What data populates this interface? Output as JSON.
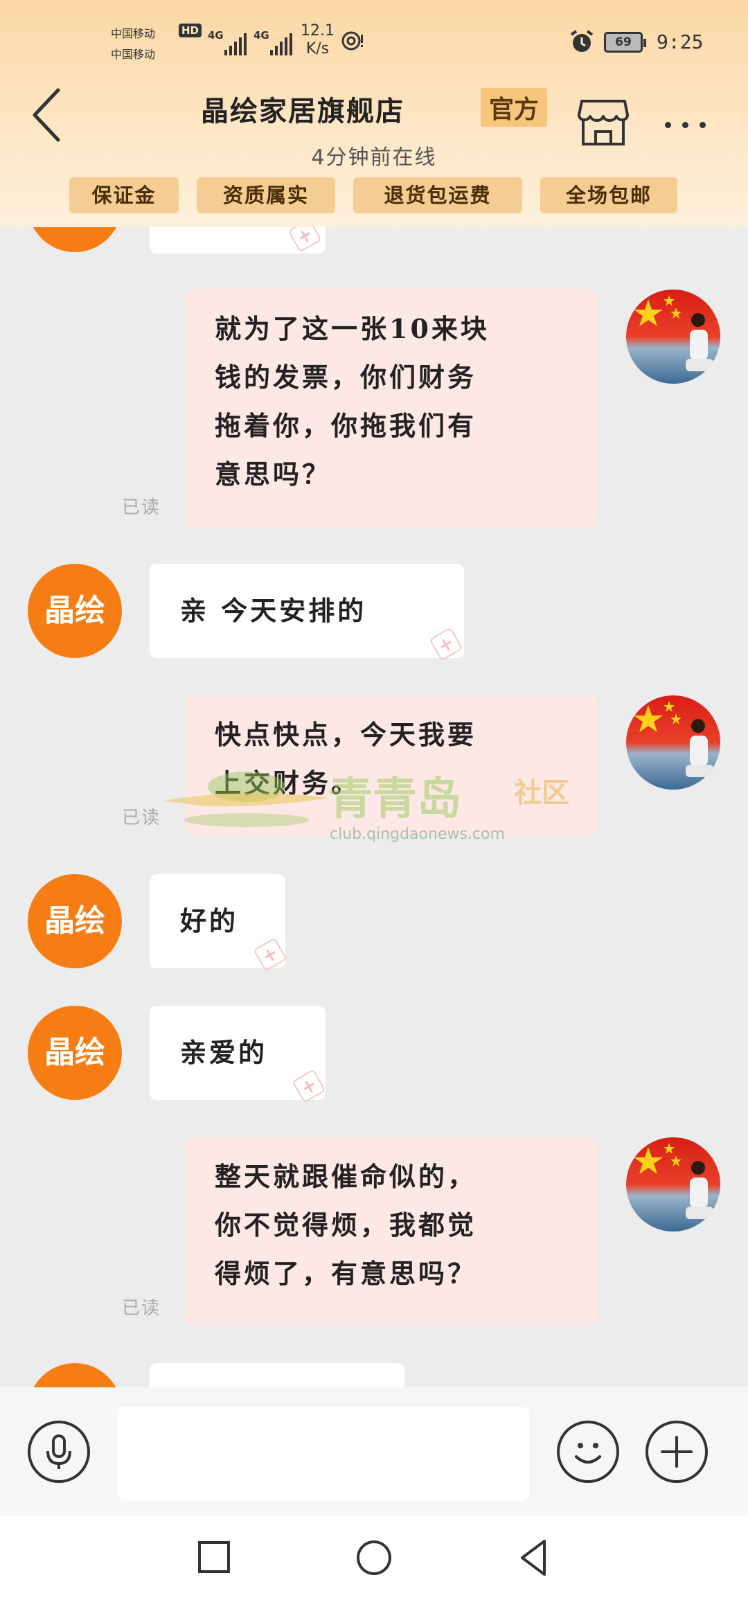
{
  "status_bar": {
    "carrier1": "中国移动",
    "carrier2": "中国移动",
    "hd": "HD",
    "network1": "4G",
    "network2": "4G",
    "speed_value": "12.1",
    "speed_unit": "K/s",
    "battery": "69",
    "time": "9:25"
  },
  "header": {
    "store_name": "晶绘家居旗舰店",
    "official_badge": "官方",
    "online_status": "4分钟前在线",
    "tags": [
      "保证金",
      "资质属实",
      "退货包运费",
      "全场包邮"
    ]
  },
  "chat": {
    "messages": [
      {
        "from": "user",
        "lines": [
          "就为了这一张10来块",
          "钱的发票，你们财务",
          "拖着你，你拖我们有",
          "意思吗？"
        ],
        "read": "已读"
      },
      {
        "from": "store",
        "avatar": "晶绘",
        "lines": [
          "亲  今天安排的"
        ]
      },
      {
        "from": "user",
        "lines": [
          "快点快点，今天我要",
          "上交财务。"
        ],
        "read": "已读"
      },
      {
        "from": "store",
        "avatar": "晶绘",
        "lines": [
          "好的"
        ]
      },
      {
        "from": "store",
        "avatar": "晶绘",
        "lines": [
          "亲爱的"
        ]
      },
      {
        "from": "user",
        "lines": [
          "整天就跟催命似的，",
          "你不觉得烦，我都觉",
          "得烦了，有意思吗？"
        ],
        "read": "已读"
      }
    ],
    "watermark": {
      "name": "青青岛",
      "suffix": "社区",
      "url": "club.qingdaonews.com"
    }
  },
  "input": {
    "placeholder": ""
  },
  "icons": {
    "back": "chevron-left-icon",
    "store": "store-icon",
    "more": "more-dots-icon",
    "voice": "microphone-icon",
    "emoji": "smiley-icon",
    "add": "plus-icon"
  },
  "colors": {
    "accent": "#f57d14",
    "header_bg": "#fde6c4",
    "tag_bg": "#f3cd92",
    "outgoing_bubble": "#fde8e6",
    "incoming_bubble": "#ffffff",
    "chat_bg": "#ececec"
  }
}
